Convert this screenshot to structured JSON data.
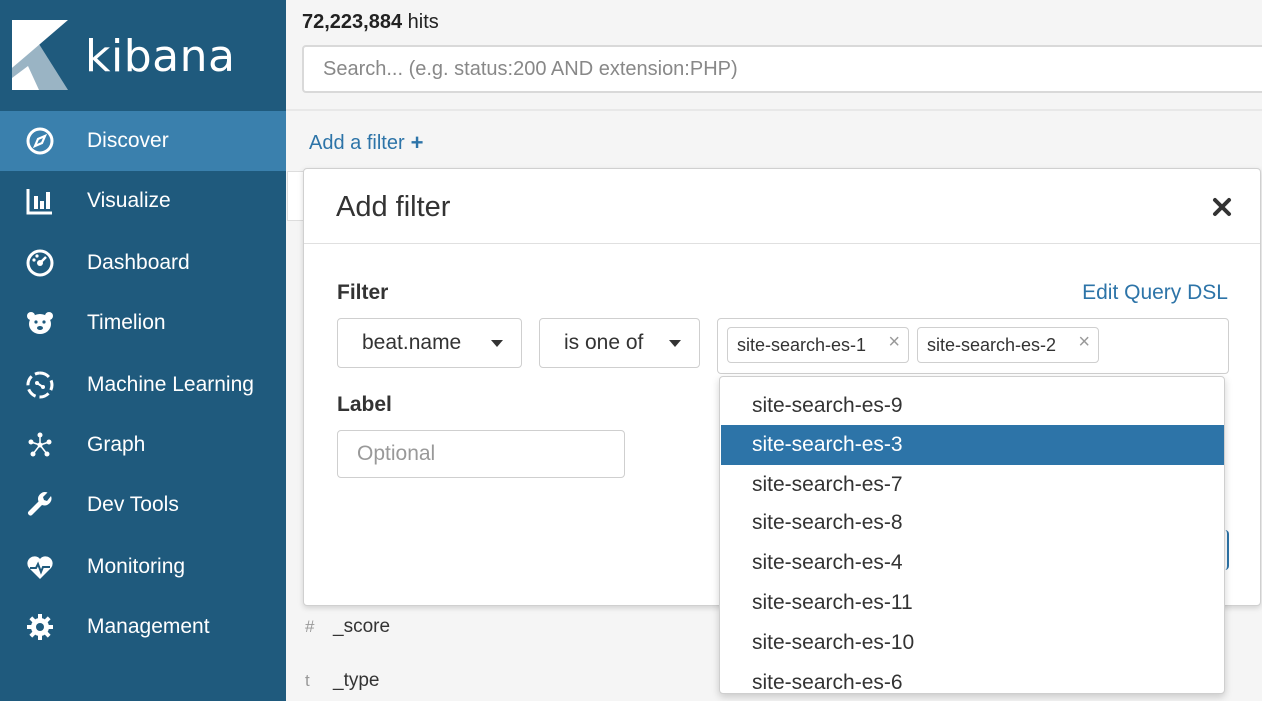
{
  "brand": {
    "name": "kibana"
  },
  "sidebar": {
    "items": [
      {
        "label": "Discover",
        "icon": "compass-icon",
        "active": true
      },
      {
        "label": "Visualize",
        "icon": "bar-chart-icon"
      },
      {
        "label": "Dashboard",
        "icon": "dashboard-gauge-icon"
      },
      {
        "label": "Timelion",
        "icon": "bear-icon"
      },
      {
        "label": "Machine Learning",
        "icon": "machine-learning-icon"
      },
      {
        "label": "Graph",
        "icon": "graph-network-icon"
      },
      {
        "label": "Dev Tools",
        "icon": "wrench-icon"
      },
      {
        "label": "Monitoring",
        "icon": "heartbeat-icon"
      },
      {
        "label": "Management",
        "icon": "gear-icon"
      }
    ]
  },
  "header": {
    "hits_count": "72,223,884",
    "hits_suffix": " hits",
    "search_placeholder": "Search... (e.g. status:200 AND extension:PHP)",
    "add_filter_label": "Add a filter",
    "add_filter_plus": "+"
  },
  "fields": [
    {
      "type": "#",
      "name": "_score"
    },
    {
      "type": "t",
      "name": "_type"
    }
  ],
  "modal": {
    "title": "Add filter",
    "filter_label": "Filter",
    "edit_dsl_label": "Edit Query DSL",
    "field_select": "beat.name",
    "operator_select": "is one of",
    "chips": [
      {
        "label": "site-search-es-1"
      },
      {
        "label": "site-search-es-2"
      }
    ],
    "chip_remove": "×",
    "label_section": "Label",
    "label_placeholder": "Optional"
  },
  "dropdown": {
    "options": [
      "site-search-es-9",
      "site-search-es-3",
      "site-search-es-7",
      "site-search-es-8",
      "site-search-es-4",
      "site-search-es-11",
      "site-search-es-10",
      "site-search-es-6"
    ],
    "highlighted_index": 1
  },
  "colors": {
    "sidebar_bg": "#1f5a7d",
    "sidebar_active": "#3a80ad",
    "accent": "#2d74a8"
  }
}
